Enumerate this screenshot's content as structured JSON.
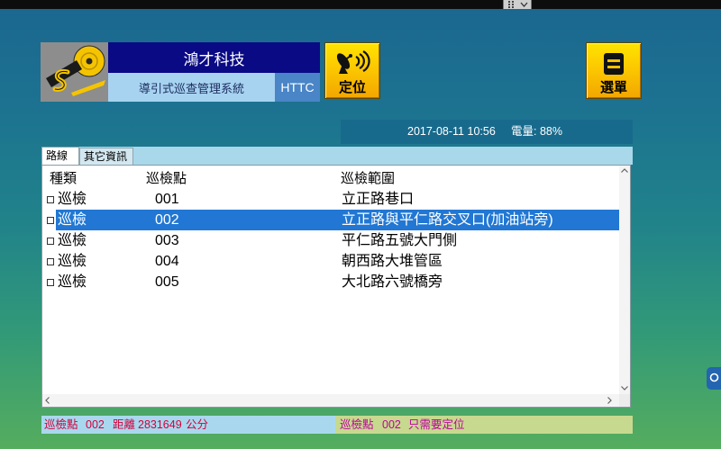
{
  "colors": {
    "title_bg": "#0a0a85",
    "subtitle_bg": "#a7d3f1",
    "code_bg": "#4985c7",
    "status_bg": "#186a8c",
    "tab_strip": "#a9d8ea",
    "selected_row": "#2177d3",
    "footer_left_bg": "#a9d8ee",
    "footer_left_fg": "#d4003c",
    "footer_right_bg": "#c7d98e",
    "footer_right_fg": "#c000a0"
  },
  "header": {
    "company": "鴻才科技",
    "system_name": "導引式巡查管理系統",
    "code": "HTTC",
    "locate_label": "定位",
    "locate_icon": "satellite-dish-icon",
    "menu_label": "選單",
    "menu_icon": "menu-icon"
  },
  "status": {
    "datetime": "2017-08-11 10:56",
    "battery": "電量: 88%"
  },
  "tabs": [
    {
      "label": "路線",
      "active": true
    },
    {
      "label": "其它資訊",
      "active": false
    }
  ],
  "table": {
    "columns": [
      "種類",
      "巡檢點",
      "巡檢範圍"
    ],
    "selected_index": 1,
    "rows": [
      {
        "type": "巡檢",
        "point": "001",
        "area": "立正路巷口",
        "checked": false
      },
      {
        "type": "巡檢",
        "point": "002",
        "area": "立正路與平仁路交叉口(加油站旁)",
        "checked": false
      },
      {
        "type": "巡檢",
        "point": "003",
        "area": "平仁路五號大門側",
        "checked": false
      },
      {
        "type": "巡檢",
        "point": "004",
        "area": "朝西路大堆管區",
        "checked": false
      },
      {
        "type": "巡檢",
        "point": "005",
        "area": "大北路六號橋旁",
        "checked": false
      }
    ]
  },
  "footer": {
    "left": {
      "label": "巡檢點",
      "point": "002",
      "distance_label": "距離",
      "distance": "2831649",
      "unit": "公分"
    },
    "right": {
      "label": "巡檢點",
      "point": "002",
      "message": "只需要定位"
    }
  }
}
